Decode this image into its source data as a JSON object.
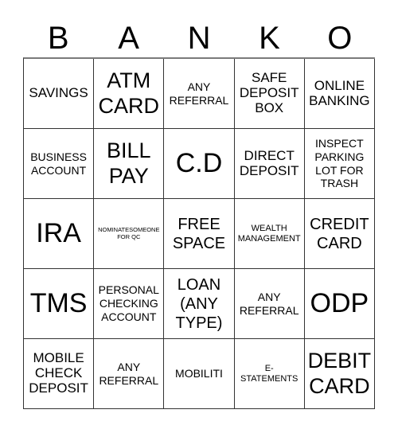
{
  "title_letters": [
    "B",
    "A",
    "N",
    "K",
    "O"
  ],
  "cells": [
    {
      "text": "SAVINGS",
      "size": "s-mdl"
    },
    {
      "text": "ATM CARD",
      "size": "s-xl"
    },
    {
      "text": "ANY REFERRAL",
      "size": "s-md"
    },
    {
      "text": "SAFE DEPOSIT BOX",
      "size": "s-mdl"
    },
    {
      "text": "ONLINE BANKING",
      "size": "s-mdl"
    },
    {
      "text": "BUSINESS ACCOUNT",
      "size": "s-md"
    },
    {
      "text": "BILL PAY",
      "size": "s-xl"
    },
    {
      "text": "C.D",
      "size": "s-xxl"
    },
    {
      "text": "DIRECT DEPOSIT",
      "size": "s-mdl"
    },
    {
      "text": "INSPECT PARKING LOT FOR TRASH",
      "size": "s-md"
    },
    {
      "text": "IRA",
      "size": "s-xxl"
    },
    {
      "text": "NOMINATESOMEONE FOR QC",
      "size": "s-xs"
    },
    {
      "text": "FREE SPACE",
      "size": "s-lg"
    },
    {
      "text": "WEALTH MANAGEMENT",
      "size": "s-sm"
    },
    {
      "text": "CREDIT CARD",
      "size": "s-lg"
    },
    {
      "text": "TMS",
      "size": "s-xxl"
    },
    {
      "text": "PERSONAL CHECKING ACCOUNT",
      "size": "s-md"
    },
    {
      "text": "LOAN (ANY TYPE)",
      "size": "s-lg"
    },
    {
      "text": "ANY REFERRAL",
      "size": "s-md"
    },
    {
      "text": "ODP",
      "size": "s-xxl"
    },
    {
      "text": "MOBILE CHECK DEPOSIT",
      "size": "s-mdl"
    },
    {
      "text": "ANY REFERRAL",
      "size": "s-md"
    },
    {
      "text": "MOBILITI",
      "size": "s-md"
    },
    {
      "text": "E-STATEMENTS",
      "size": "s-sm"
    },
    {
      "text": "DEBIT CARD",
      "size": "s-xl"
    }
  ]
}
